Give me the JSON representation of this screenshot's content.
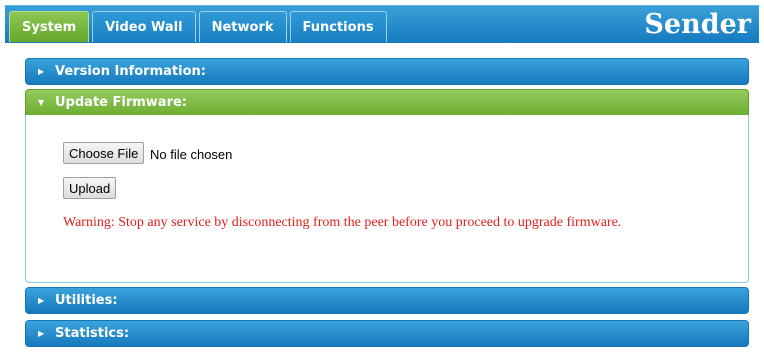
{
  "tabs": [
    {
      "label": "System",
      "active": true
    },
    {
      "label": "Video Wall",
      "active": false
    },
    {
      "label": "Network",
      "active": false
    },
    {
      "label": "Functions",
      "active": false
    }
  ],
  "brand": "Sender",
  "sections": {
    "version": {
      "title": "Version Information:",
      "expanded": false
    },
    "firmware": {
      "title": "Update Firmware:",
      "expanded": true
    },
    "utilities": {
      "title": "Utilities:",
      "expanded": false
    },
    "statistics": {
      "title": "Statistics:",
      "expanded": false
    }
  },
  "firmware": {
    "choose_file_label": "Choose File",
    "file_status": "No file chosen",
    "upload_label": "Upload",
    "warning": "Warning: Stop any service by disconnecting from the peer before you proceed to upgrade firmware."
  },
  "colors": {
    "accent_blue": "#1a80c4",
    "accent_green": "#6dae33",
    "warning_red": "#e0201a"
  }
}
